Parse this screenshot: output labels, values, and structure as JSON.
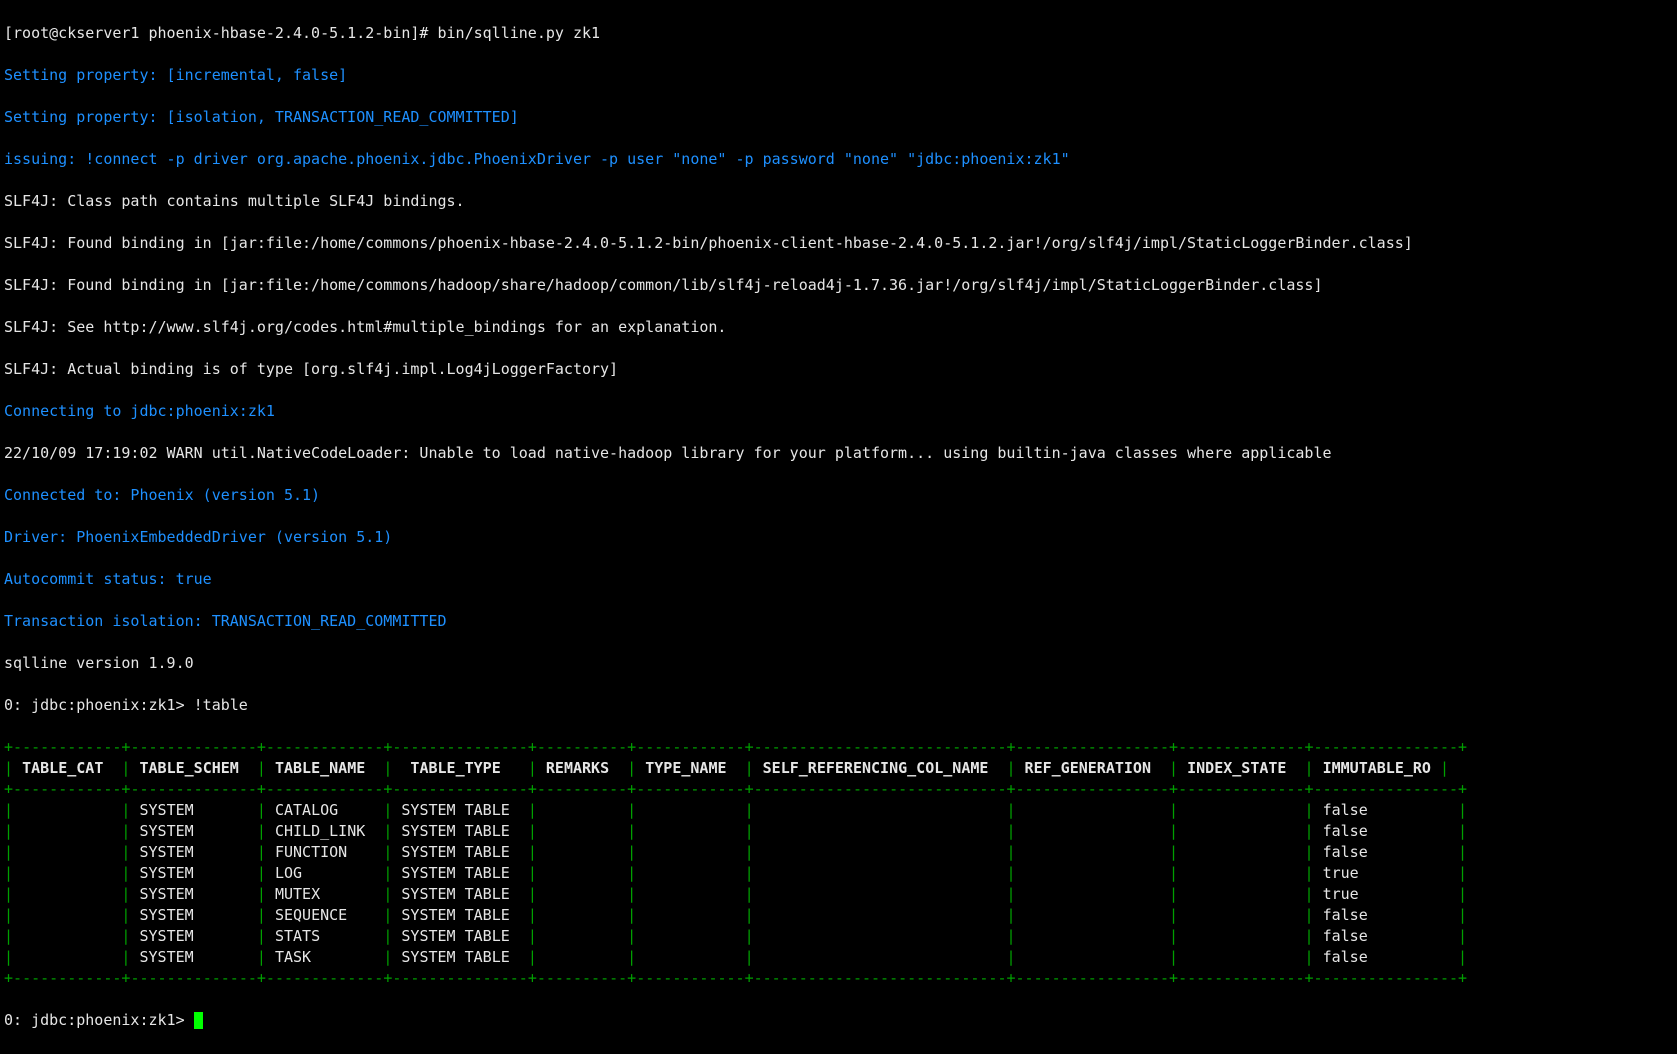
{
  "prompt_line": "[root@ckserver1 phoenix-hbase-2.4.0-5.1.2-bin]# bin/sqlline.py zk1",
  "blue_lines": {
    "b0": "Setting property: [incremental, false]",
    "b1": "Setting property: [isolation, TRANSACTION_READ_COMMITTED]",
    "b2": "issuing: !connect -p driver org.apache.phoenix.jdbc.PhoenixDriver -p user \"none\" -p password \"none\" \"jdbc:phoenix:zk1\"",
    "b3": "Connecting to jdbc:phoenix:zk1",
    "b4": "Connected to: Phoenix (version 5.1)",
    "b5": "Driver: PhoenixEmbeddedDriver (version 5.1)",
    "b6": "Autocommit status: true",
    "b7": "Transaction isolation: TRANSACTION_READ_COMMITTED"
  },
  "white_lines": {
    "w0": "SLF4J: Class path contains multiple SLF4J bindings.",
    "w1": "SLF4J: Found binding in [jar:file:/home/commons/phoenix-hbase-2.4.0-5.1.2-bin/phoenix-client-hbase-2.4.0-5.1.2.jar!/org/slf4j/impl/StaticLoggerBinder.class]",
    "w2": "SLF4J: Found binding in [jar:file:/home/commons/hadoop/share/hadoop/common/lib/slf4j-reload4j-1.7.36.jar!/org/slf4j/impl/StaticLoggerBinder.class]",
    "w3": "SLF4J: See http://www.slf4j.org/codes.html#multiple_bindings for an explanation.",
    "w4": "SLF4J: Actual binding is of type [org.slf4j.impl.Log4jLoggerFactory]",
    "w5": "22/10/09 17:19:02 WARN util.NativeCodeLoader: Unable to load native-hadoop library for your platform... using builtin-java classes where applicable",
    "w6": "sqlline version 1.9.0",
    "w7": "0: jdbc:phoenix:zk1> !table",
    "w8": "0: jdbc:phoenix:zk1> "
  },
  "table": {
    "border_top": "+------------+--------------+-------------+---------------+----------+------------+----------------------------+-----------------+--------------+----------------+",
    "header": "| TABLE_CAT  | TABLE_SCHEM  | TABLE_NAME  |  TABLE_TYPE   | REMARKS  | TYPE_NAME  | SELF_REFERENCING_COL_NAME  | REF_GENERATION  | INDEX_STATE  | IMMUTABLE_RO |",
    "border_mid": "+------------+--------------+-------------+---------------+----------+------------+----------------------------+-----------------+--------------+----------------+",
    "rows": [
      "|            | SYSTEM       | CATALOG     | SYSTEM TABLE  |          |            |                            |                 |              | false          |",
      "|            | SYSTEM       | CHILD_LINK  | SYSTEM TABLE  |          |            |                            |                 |              | false          |",
      "|            | SYSTEM       | FUNCTION    | SYSTEM TABLE  |          |            |                            |                 |              | false          |",
      "|            | SYSTEM       | LOG         | SYSTEM TABLE  |          |            |                            |                 |              | true           |",
      "|            | SYSTEM       | MUTEX       | SYSTEM TABLE  |          |            |                            |                 |              | true           |",
      "|            | SYSTEM       | SEQUENCE    | SYSTEM TABLE  |          |            |                            |                 |              | false          |",
      "|            | SYSTEM       | STATS       | SYSTEM TABLE  |          |            |                            |                 |              | false          |",
      "|            | SYSTEM       | TASK        | SYSTEM TABLE  |          |            |                            |                 |              | false          |"
    ],
    "border_bot": "+------------+--------------+-------------+---------------+----------+------------+----------------------------+-----------------+--------------+----------------+"
  }
}
